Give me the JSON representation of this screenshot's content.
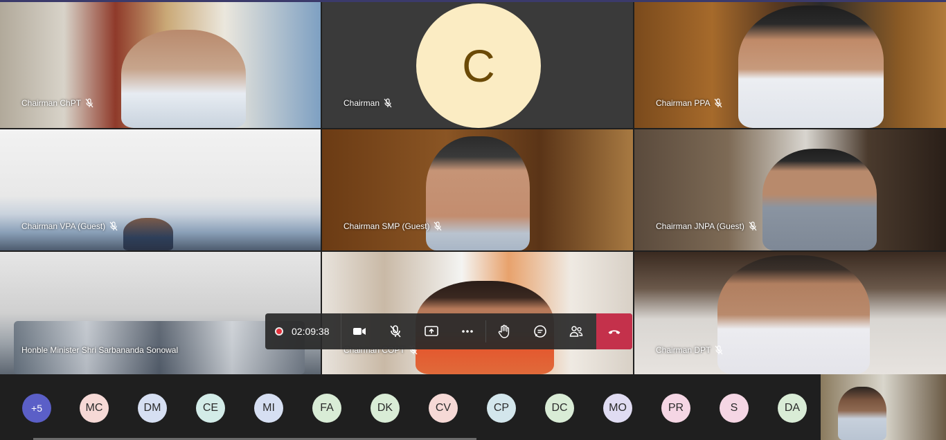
{
  "tiles": [
    {
      "name": "Chairman ChPT"
    },
    {
      "name": "Chairman",
      "avatar": "C"
    },
    {
      "name": "Chairman PPA"
    },
    {
      "name": "Chairman VPA (Guest)"
    },
    {
      "name": "Chairman SMP (Guest)"
    },
    {
      "name": "Chairman JNPA (Guest)"
    },
    {
      "name": "Honble Minister Shri Sarbananda Sonowal"
    },
    {
      "name": "Chairman COPT"
    },
    {
      "name": "Chairman DPT"
    }
  ],
  "toolbar": {
    "recording_time": "02:09:38",
    "buttons": [
      "camera-icon",
      "mic-off-icon",
      "share-screen-icon",
      "more-options-icon",
      "raise-hand-icon",
      "chat-icon",
      "participants-icon",
      "hang-up-icon"
    ]
  },
  "roster": {
    "more": "+5",
    "chips": [
      {
        "initials": "MC",
        "color": "#f6d9d6"
      },
      {
        "initials": "DM",
        "color": "#d6dff2"
      },
      {
        "initials": "CE",
        "color": "#d3ece8"
      },
      {
        "initials": "MI",
        "color": "#d6dff2"
      },
      {
        "initials": "FA",
        "color": "#d9ecd6"
      },
      {
        "initials": "DK",
        "color": "#d9ecd6"
      },
      {
        "initials": "CV",
        "color": "#f6d9d6"
      },
      {
        "initials": "CP",
        "color": "#d3e6ec"
      },
      {
        "initials": "DC",
        "color": "#d9ecd6"
      },
      {
        "initials": "MO",
        "color": "#e0dcf2"
      },
      {
        "initials": "PR",
        "color": "#f5d6e4"
      },
      {
        "initials": "S",
        "color": "#f5d6e4"
      },
      {
        "initials": "DA",
        "color": "#d9ecd6"
      }
    ]
  },
  "colors": {
    "hangup": "#c4314b",
    "more_chip": "#5b5fc7",
    "record": "#e3313b"
  }
}
